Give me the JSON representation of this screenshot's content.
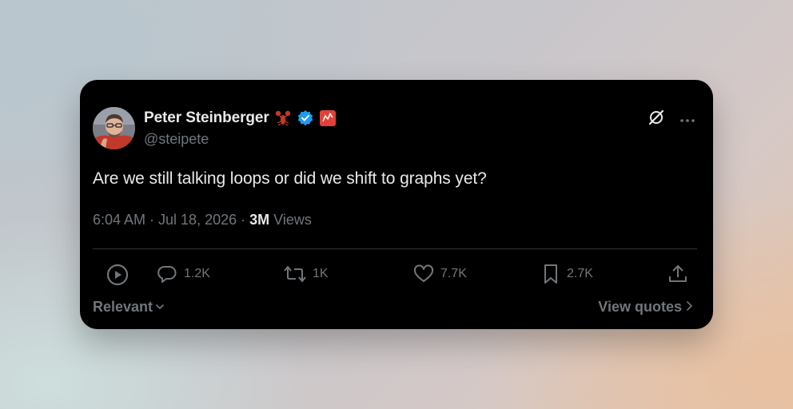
{
  "tweet": {
    "author": {
      "name": "Peter Steinberger",
      "handle": "@steipete",
      "badges": [
        "lobster-emoji-icon",
        "verified-badge-icon",
        "red-flag-icon"
      ],
      "verified_color": "#1d9bf0"
    },
    "text": "Are we still talking loops or did we shift to graphs yet?",
    "timestamp": "6:04 AM · Jul 18, 2026 · ",
    "views_count": "3M",
    "views_label": " Views",
    "stats": {
      "replies": "1.2K",
      "reposts": "1K",
      "likes": "7.7K",
      "bookmarks": "2.7K"
    },
    "icons": {
      "play": "play-circle-icon",
      "reply": "reply-icon",
      "repost": "repost-icon",
      "like": "heart-icon",
      "bookmark": "bookmark-icon",
      "share": "share-icon",
      "grok": "grok-icon",
      "more": "more-icon"
    }
  },
  "footer": {
    "sort_label": "Relevant",
    "quotes_label": "View quotes"
  },
  "colors": {
    "card_background": "#000000",
    "primary_text": "#e7e9ea",
    "secondary_text": "#71767b",
    "divider": "#2f3336"
  }
}
